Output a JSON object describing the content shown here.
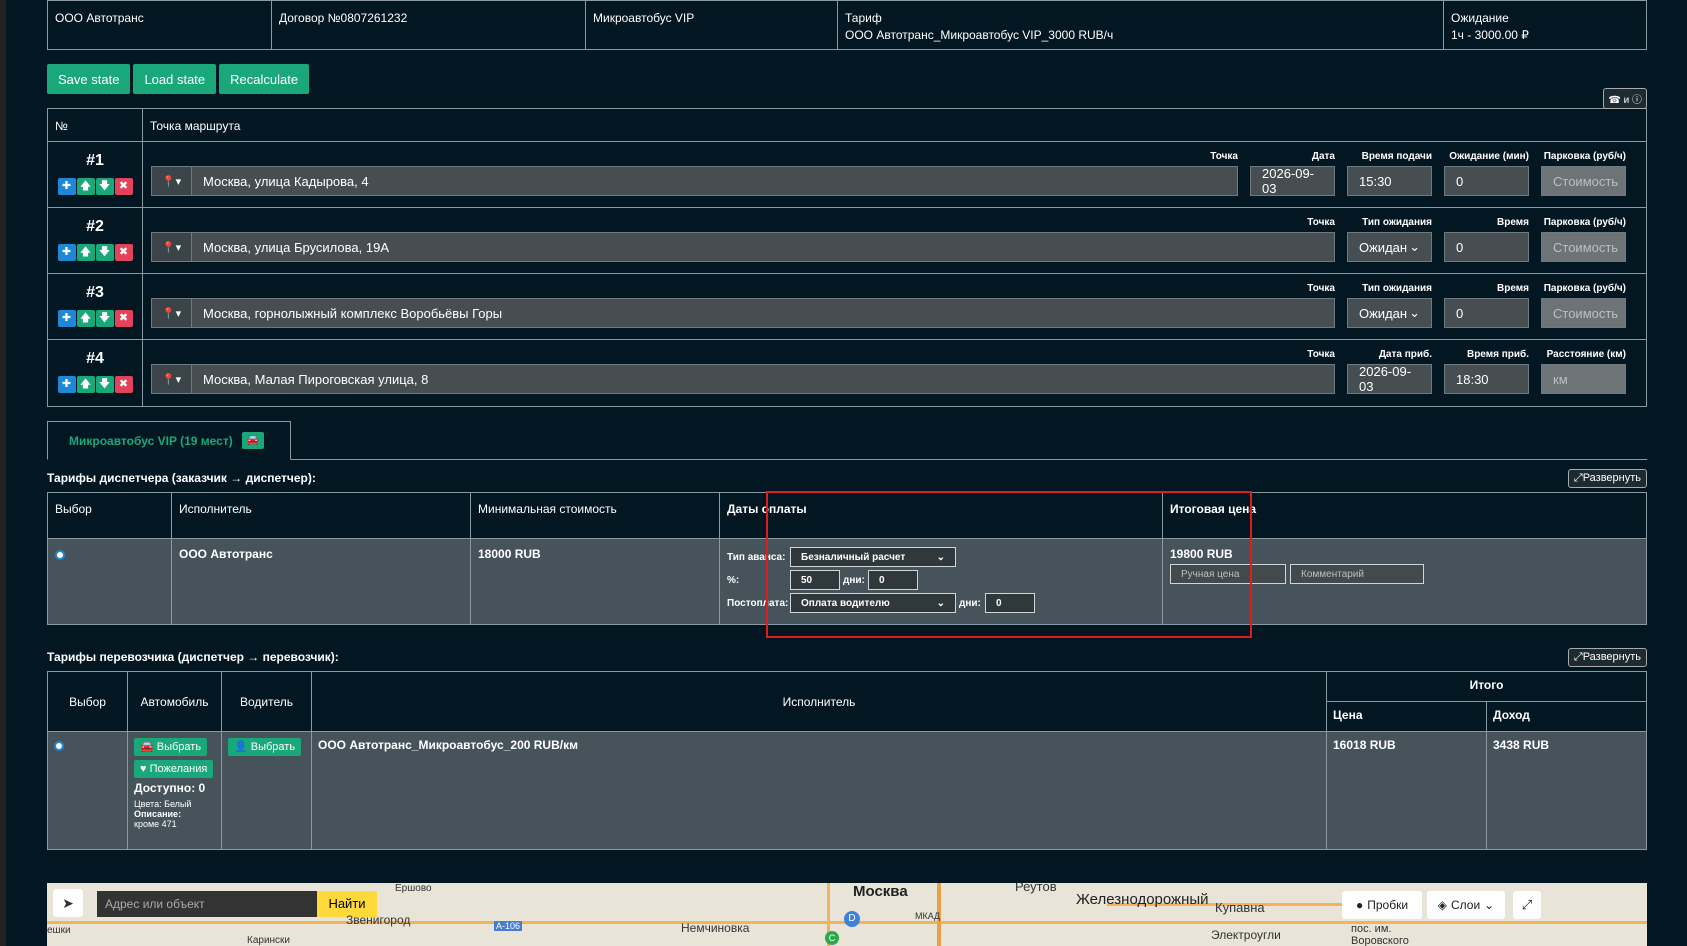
{
  "header": {
    "company": "ООО Автотранс",
    "contract": "Договор №0807261232",
    "vehicle": "Микроавтобус VIP",
    "tariff_label": "Тариф",
    "tariff_value": "ООО Автотранс_Микроавтобус VIP_3000 RUB/ч",
    "wait_label": "Ожидание",
    "wait_value": "1ч - 3000.00 ₽"
  },
  "toolbar": {
    "save": "Save state",
    "load": "Load state",
    "recalc": "Recalculate",
    "phone_info": "☎ и ⓘ"
  },
  "route": {
    "col_num": "№",
    "col_point": "Точка маршрута",
    "rows": [
      {
        "n": "#1",
        "point_label": "Точка",
        "address": "Москва, улица Кадырова, 4",
        "l1": "Дата",
        "v1": "2026-09-03",
        "l2": "Время подачи",
        "v2": "15:30",
        "l3": "Ожидание (мин)",
        "v3": "0",
        "l4": "Парковка (руб/ч)",
        "v4": "Стоимость"
      },
      {
        "n": "#2",
        "point_label": "Точка",
        "address": "Москва, улица Брусилова, 19А",
        "l2": "Тип ожидания",
        "v2": "Ожидан",
        "l3": "Время",
        "v3": "0",
        "l4": "Парковка (руб/ч)",
        "v4": "Стоимость"
      },
      {
        "n": "#3",
        "point_label": "Точка",
        "address": "Москва, горнолыжный комплекс Воробьёвы Горы",
        "l2": "Тип ожидания",
        "v2": "Ожидан",
        "l3": "Время",
        "v3": "0",
        "l4": "Парковка (руб/ч)",
        "v4": "Стоимость"
      },
      {
        "n": "#4",
        "point_label": "Точка",
        "address": "Москва, Малая Пироговская улица, 8",
        "l2": "Дата приб.",
        "v2": "2026-09-03",
        "l3": "Время приб.",
        "v3": "18:30",
        "l4": "Расстояние (км)",
        "v4": "км"
      }
    ]
  },
  "tab": {
    "label": "Микроавтобус VIP (19 мест)"
  },
  "dispatcher": {
    "title": "Тарифы диспетчера (заказчик → диспетчер):",
    "expand": "Развернуть",
    "cols": [
      "Выбор",
      "Исполнитель",
      "Минимальная стоимость",
      "Даты оплаты",
      "Итоговая цена"
    ],
    "row": {
      "executor": "ООО Автотранс",
      "min_cost": "18000 RUB",
      "advance_label": "Тип аванса:",
      "advance_value": "Безналичный расчет",
      "pct_label": "%:",
      "pct_value": "50",
      "days_label": "дни:",
      "days_value": "0",
      "post_label": "Постоплата:",
      "post_value": "Оплата водителю",
      "post_days_label": "дни:",
      "post_days_value": "0",
      "total": "19800 RUB",
      "manual_price_placeholder": "Ручная цена",
      "comment_placeholder": "Комментарий"
    }
  },
  "carrier": {
    "title": "Тарифы перевозчика (диспетчер → перевозчик):",
    "expand": "Развернуть",
    "cols": {
      "choice": "Выбор",
      "car": "Автомобиль",
      "driver": "Водитель",
      "executor": "Исполнитель",
      "total": "Итого",
      "price": "Цена",
      "income": "Доход"
    },
    "row": {
      "choose_car": "Выбрать",
      "wishes": "Пожелания",
      "available": "Доступно: 0",
      "colors": "Цвета: Белый",
      "desc_label": "Описание:",
      "desc_value": "кроме 471",
      "choose_driver": "Выбрать",
      "executor": "ООО Автотранс_Микроавтобус_200 RUB/км",
      "price": "16018 RUB",
      "income": "3438 RUB"
    }
  },
  "map": {
    "search_placeholder": "Адрес или объект",
    "find": "Найти",
    "traffic": "Пробки",
    "layers": "Слои",
    "labels": [
      "Москва",
      "Реутов",
      "Железнодорожный",
      "Купавна",
      "Ершово",
      "Звенигород",
      "Немчиновка",
      "Электроугли",
      "пос. им. Воровского",
      "Карински",
      "ешки",
      "А-106",
      "МКАД",
      "D",
      "C"
    ]
  }
}
